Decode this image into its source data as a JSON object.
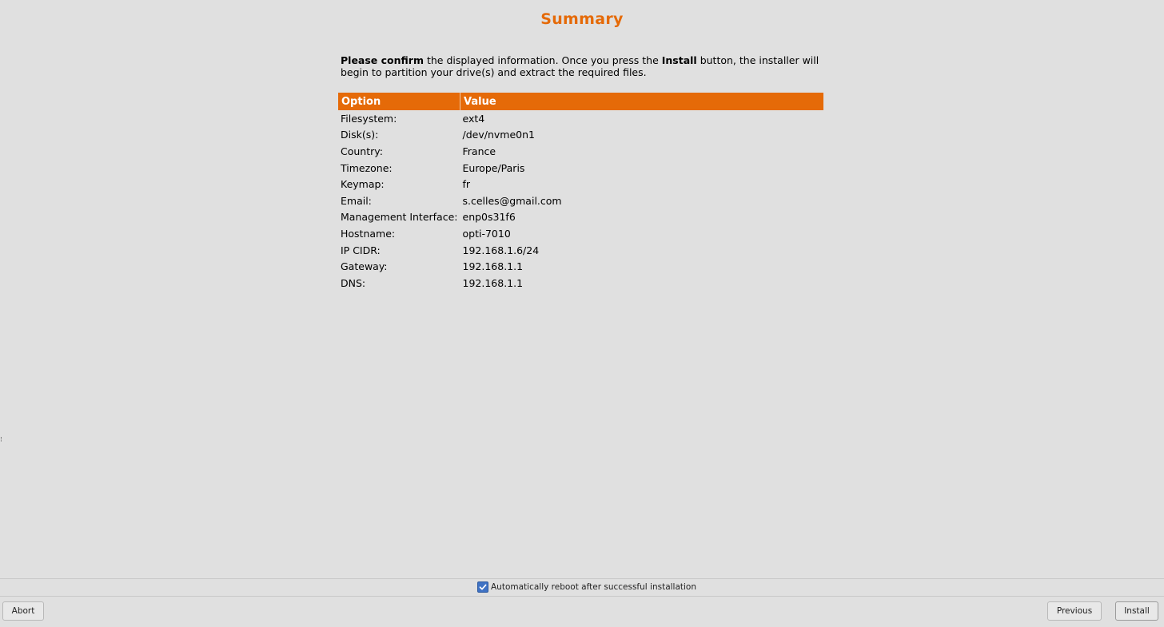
{
  "page": {
    "title": "Summary",
    "intro": {
      "bold1": "Please confirm",
      "text1": " the displayed information. Once you press the ",
      "bold2": "Install",
      "text2": " button, the installer will begin to partition your drive(s) and extract the required files."
    }
  },
  "table": {
    "headers": [
      "Option",
      "Value"
    ],
    "rows": [
      {
        "option": "Filesystem:",
        "value": "ext4"
      },
      {
        "option": "Disk(s):",
        "value": "/dev/nvme0n1"
      },
      {
        "option": "Country:",
        "value": "France"
      },
      {
        "option": "Timezone:",
        "value": "Europe/Paris"
      },
      {
        "option": "Keymap:",
        "value": "fr"
      },
      {
        "option": "Email:",
        "value": "s.celles@gmail.com"
      },
      {
        "option": "Management Interface:",
        "value": "enp0s31f6"
      },
      {
        "option": "Hostname:",
        "value": "opti-7010"
      },
      {
        "option": "IP CIDR:",
        "value": "192.168.1.6/24"
      },
      {
        "option": "Gateway:",
        "value": "192.168.1.1"
      },
      {
        "option": "DNS:",
        "value": "192.168.1.1"
      }
    ]
  },
  "footer": {
    "reboot_label": "Automatically reboot after successful installation",
    "reboot_checked": true,
    "abort_label": "Abort",
    "previous_label": "Previous",
    "install_label": "Install"
  },
  "colors": {
    "accent": "#e56a08",
    "checkbox": "#3f72c4",
    "background": "#e0e0e0"
  }
}
